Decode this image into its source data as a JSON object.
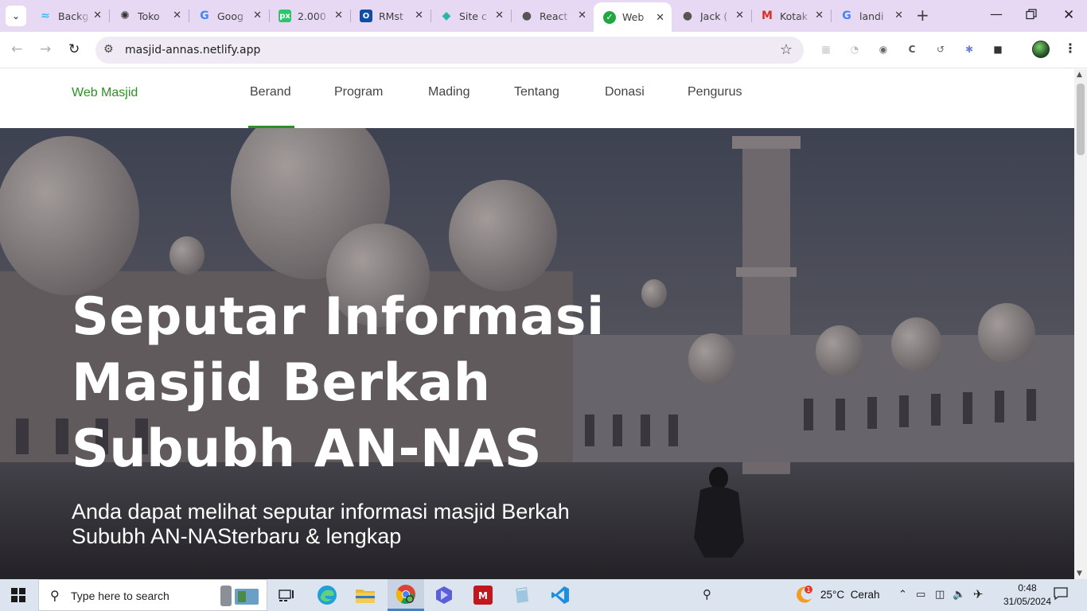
{
  "browser": {
    "tabs": [
      {
        "title": "Backg",
        "favicon": "tailwind-icon",
        "color": "#38bdf8"
      },
      {
        "title": "Toko",
        "favicon": "chatgpt-icon",
        "color": "#333333"
      },
      {
        "title": "Goog",
        "favicon": "google-translate-icon",
        "color": "#4285f4"
      },
      {
        "title": "2.000",
        "favicon": "pixabay-icon",
        "color": "#2ec66d"
      },
      {
        "title": "RMst",
        "favicon": "outlook-icon",
        "color": "#0f4ea3"
      },
      {
        "title": "Site c",
        "favicon": "netlify-icon",
        "color": "#25b7a8"
      },
      {
        "title": "React",
        "favicon": "globe-icon",
        "color": "#555555"
      },
      {
        "title": "Web",
        "favicon": "check-circle-icon",
        "color": "#1fa842"
      },
      {
        "title": "Jack (",
        "favicon": "globe-icon",
        "color": "#555555"
      },
      {
        "title": "Kotak",
        "favicon": "gmail-icon",
        "color": "#d93025"
      },
      {
        "title": "landi",
        "favicon": "google-icon",
        "color": "#4285f4"
      }
    ],
    "active_tab_index": 7,
    "url": "masjid-annas.netlify.app"
  },
  "site": {
    "brand": "Web Masjid",
    "nav": [
      "Berand",
      "Program",
      "Mading",
      "Tentang",
      "Donasi",
      "Pengurus"
    ],
    "active_nav": "Berand",
    "accent": "#2d8f25",
    "hero_title_lines": [
      "Seputar Informasi",
      "Masjid Berkah",
      "Sububh AN-NAS"
    ],
    "hero_subtitle": "Anda dapat melihat seputar informasi masjid Berkah Sububh AN-NASterbaru & lengkap"
  },
  "taskbar": {
    "search_placeholder": "Type here to search",
    "weather_temp": "25°C",
    "weather_text": "Cerah",
    "weather_badge": "1",
    "time": "0:48",
    "date": "31/05/2024"
  }
}
